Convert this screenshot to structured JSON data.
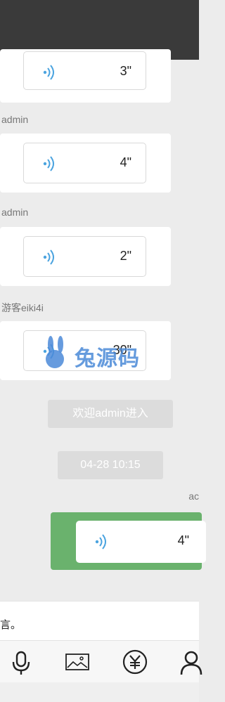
{
  "messages": [
    {
      "sender": "",
      "duration": "3\""
    },
    {
      "sender": "admin",
      "duration": "4\""
    },
    {
      "sender": "admin",
      "duration": "2\""
    },
    {
      "sender": "游客eiki4i",
      "duration": "30\""
    }
  ],
  "system": {
    "welcome": "欢迎admin进入",
    "timestamp": "04-28 10:15"
  },
  "own_message": {
    "sender": "ac",
    "duration": "4\""
  },
  "input": {
    "text": "言。"
  },
  "toolbar": {
    "icons": [
      "microphone-icon",
      "image-icon",
      "yen-icon",
      "user-icon"
    ]
  },
  "branding": {
    "logo_text": "兔源码"
  },
  "colors": {
    "topbar": "#3a3a3a",
    "accent_green": "#6ab26d",
    "voice_blue": "#4aa3df"
  }
}
